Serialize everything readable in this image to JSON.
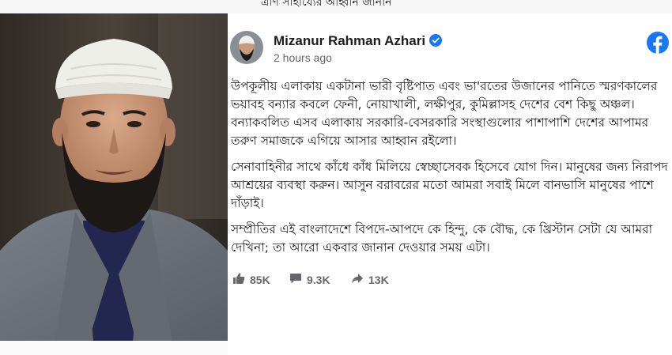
{
  "top_cut_text": "ত্রাণ সাহায্যের আহ্বান জানান",
  "post": {
    "author_name": "Mizanur Rahman Azhari",
    "verified": true,
    "timestamp": "2 hours ago",
    "paragraphs": [
      "উপকূলীয় এলাকায় একটানা ভারী বৃষ্টিপাত এবং ভা'রতের উজানের পানিতে স্মরণকালের ভয়াবহ বন্যার কবলে ফেনী, নোয়াখালী, লক্ষীপুর, কুমিল্লাসহ দেশের বেশ কিছু অঞ্চল। বন্যাকবলিত এসব এলাকায় সরকারি-বেসরকারি সংস্থাগুলোর পাশাপাশি দেশের আপামর তরুণ সমাজকে এগিয়ে আসার আহ্বান রইলো।",
      "সেনাবাহিনীর সাথে কাঁধে কাঁধ মিলিয়ে স্বেচ্ছাসেবক হিসেবে যোগ দিন। মানুষের জন্য নিরাপদ আশ্রয়ের ব্যবস্থা করুন। আসুন বরাবরের মতো আমরা সবাই মিলে বানভাসি মানুষের পাশে দাঁড়াই।",
      "সম্প্রীতির এই বাংলাদেশে বিপদে-আপদে কে হিন্দু, কে বৌদ্ধ, কে খ্রিস্টান সেটা যে আমরা দেখিনা; তা আরো একবার জানান দেওয়ার সময় এটা।"
    ],
    "likes": "85K",
    "comments": "9.3K",
    "shares": "13K"
  },
  "colors": {
    "facebook_blue": "#1877F2",
    "stat_gray": "#65676b",
    "cap_white": "#efefe9",
    "suit_gray": "#6d727a",
    "shirt_navy": "#23264f"
  },
  "icons": [
    "facebook-logo-icon",
    "verified-badge-icon",
    "like-icon",
    "comment-icon",
    "share-icon"
  ]
}
